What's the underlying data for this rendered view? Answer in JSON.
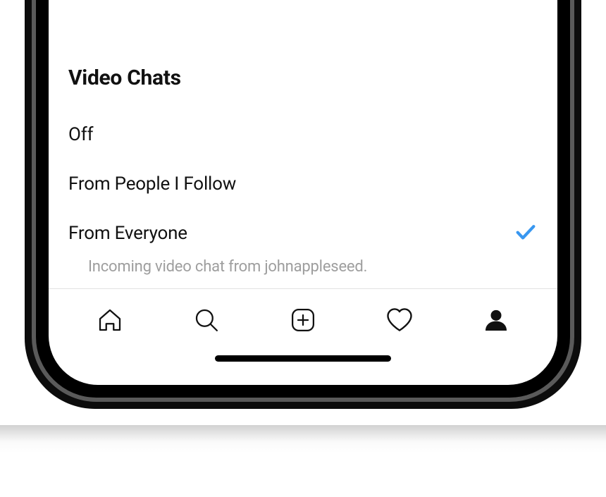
{
  "section": {
    "title": "Video Chats",
    "options": [
      {
        "label": "Off",
        "selected": false
      },
      {
        "label": "From People I Follow",
        "selected": false
      },
      {
        "label": "From Everyone",
        "selected": true
      }
    ],
    "helper": "Incoming video chat from johnappleseed."
  },
  "tabs": {
    "active_index": 4
  },
  "colors": {
    "accent": "#3897f0"
  }
}
